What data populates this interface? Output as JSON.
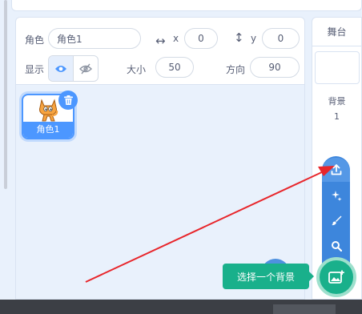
{
  "sprite_info": {
    "sprite_label": "角色",
    "sprite_name": "角色1",
    "x_label": "x",
    "x_value": "0",
    "y_label": "y",
    "y_value": "0",
    "show_label": "显示",
    "size_label": "大小",
    "size_value": "50",
    "direction_label": "方向",
    "direction_value": "90"
  },
  "sprite_list": {
    "items": [
      {
        "name": "角色1",
        "selected": true
      }
    ]
  },
  "stage": {
    "header": "舞台",
    "backdrops_label": "背景",
    "backdrops_count": "1"
  },
  "backdrop_menu": {
    "items": [
      "upload-icon",
      "surprise-icon",
      "paint-icon",
      "search-icon"
    ],
    "tooltip": "选择一个背景"
  },
  "colors": {
    "accent": "#4c97ff",
    "menu": "#3d86dc",
    "green": "#19b08b",
    "annotation_arrow": "#e8262b"
  }
}
